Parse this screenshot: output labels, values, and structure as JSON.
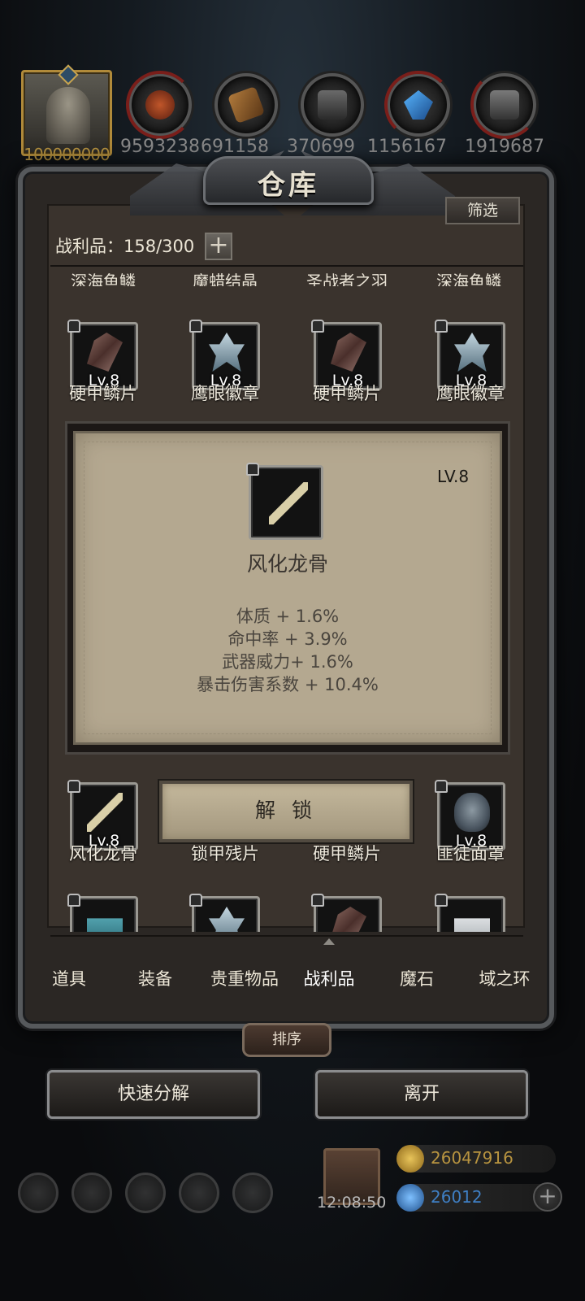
{
  "resources": {
    "avatar_value": "100000000",
    "values": [
      "9593238",
      "691158",
      "370699",
      "1156167",
      "1919687"
    ],
    "icons": [
      "leather-icon",
      "wood-plank-icon",
      "iron-ingot-icon",
      "blue-crystal-icon",
      "steel-ingot-icon"
    ]
  },
  "window": {
    "title": "仓库",
    "filter_label": "筛选",
    "loot_count": "战利品：158/300",
    "plus_label": "+"
  },
  "grid": {
    "row0_cut": [
      "深海鱼鳞",
      "魔蜡结晶",
      "圣战者之羽",
      "深海鱼鳞"
    ],
    "row1": [
      {
        "name": "硬甲鳞片",
        "level": "Lv.8",
        "icon": "scale-icon"
      },
      {
        "name": "鹰眼徽章",
        "level": "Lv.8",
        "icon": "badge-icon"
      },
      {
        "name": "硬甲鳞片",
        "level": "Lv.8",
        "icon": "scale-icon"
      },
      {
        "name": "鹰眼徽章",
        "level": "Lv.8",
        "icon": "badge-icon"
      }
    ],
    "row2": [
      {
        "name": "风化龙骨",
        "level": "Lv.8",
        "icon": "bone-icon"
      },
      {
        "name": "锁甲残片",
        "level": "",
        "icon": ""
      },
      {
        "name": "硬甲鳞片",
        "level": "",
        "icon": ""
      },
      {
        "name": "匪徒面罩",
        "level": "Lv.8",
        "icon": "mask-icon"
      }
    ],
    "row3_icons": [
      "cyan-cup-icon",
      "badge-icon",
      "scale-icon",
      "white-cup-icon"
    ]
  },
  "detail": {
    "level": "LV.8",
    "name": "风化龙骨",
    "stats": [
      "体质 + 1.6%",
      "命中率 + 3.9%",
      "武器威力+ 1.6%",
      "暴击伤害系数 + 10.4%"
    ],
    "unlock_label": "解 锁"
  },
  "tabs": [
    "道具",
    "装备",
    "贵重物品",
    "战利品",
    "魔石",
    "域之环"
  ],
  "active_tab": "战利品",
  "sort_label": "排序",
  "actions": {
    "decompose": "快速分解",
    "leave": "离开"
  },
  "bottom": {
    "clock": "12:08:50",
    "gold": "26047916",
    "gems": "26012",
    "add_label": "+"
  },
  "colors": {
    "gold_text": "#b89440",
    "gem_text": "#3f7fc4"
  }
}
